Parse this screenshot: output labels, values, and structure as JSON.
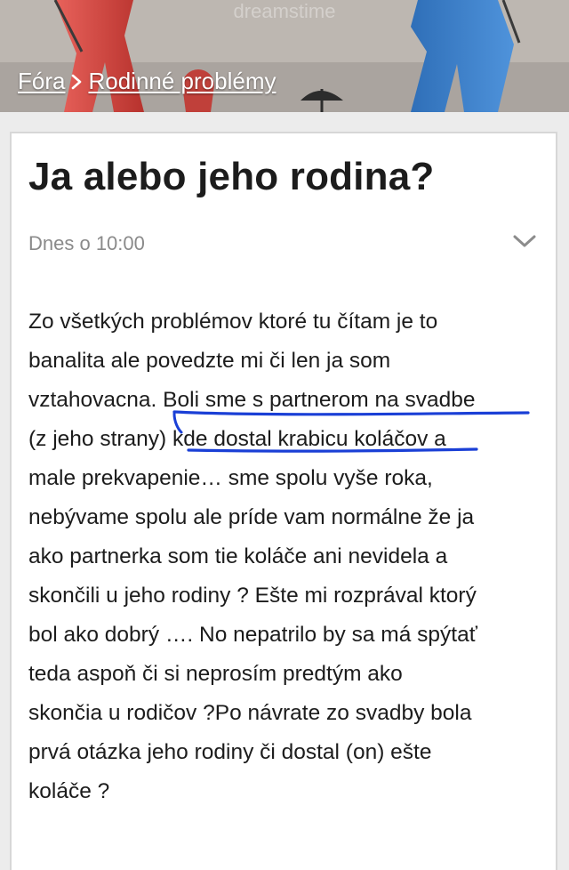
{
  "breadcrumb": {
    "items": [
      {
        "label": "Fóra"
      },
      {
        "label": "Rodinné problémy"
      }
    ],
    "separator_icon": "chevron-right-icon"
  },
  "post": {
    "title": "Ja alebo jeho rodina?",
    "timestamp": "Dnes o 10:00",
    "toggle_icon": "chevron-down-icon",
    "lines": [
      "Zo všetkých problémov ktoré tu čítam je to",
      "banalita ale povedzte mi či len ja som",
      "vztahovacna. Boli sme s partnerom na svadbe",
      "(z jeho strany) kde dostal krabicu koláčov a",
      "male prekvapenie… sme spolu vyše roka,",
      "nebývame spolu ale príde vam normálne že ja",
      "ako partnerka som tie koláče ani nevidela a",
      "skončili u jeho rodiny ? Ešte mi rozprával ktorý",
      "bol ako dobrý …. No nepatrilo by sa má spýtať",
      "teda aspoň či si neprosím predtým ako",
      "skončia u rodičov ?Po návrate zo svadby bola",
      "prvá otázka jeho rodiny či dostal (on) ešte",
      "koláče ?"
    ]
  },
  "banner": {
    "watermark": "dreamstime"
  },
  "colors": {
    "annotation": "#1a3fd6",
    "banner_bg": "#b9b3ad",
    "figure_red": "#d94a44",
    "figure_blue": "#3a7fcb"
  }
}
